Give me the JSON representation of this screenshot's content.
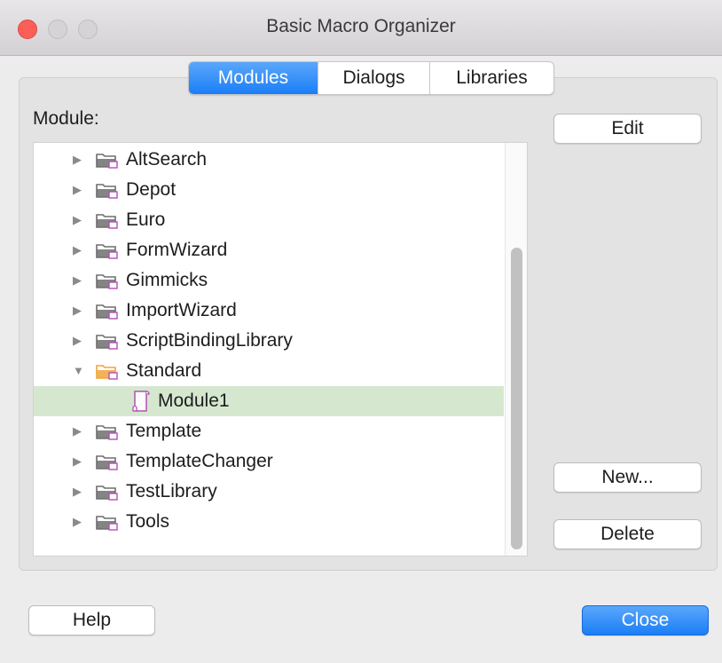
{
  "window": {
    "title": "Basic Macro Organizer"
  },
  "tabs": [
    {
      "label": "Modules",
      "active": true
    },
    {
      "label": "Dialogs",
      "active": false
    },
    {
      "label": "Libraries",
      "active": false
    }
  ],
  "module_label": "Module:",
  "tree": {
    "items": [
      {
        "label": "AltSearch",
        "expanded": false
      },
      {
        "label": "Depot",
        "expanded": false
      },
      {
        "label": "Euro",
        "expanded": false
      },
      {
        "label": "FormWizard",
        "expanded": false
      },
      {
        "label": "Gimmicks",
        "expanded": false
      },
      {
        "label": "ImportWizard",
        "expanded": false
      },
      {
        "label": "ScriptBindingLibrary",
        "expanded": false
      },
      {
        "label": "Standard",
        "expanded": true
      },
      {
        "label": "Module1",
        "child": true,
        "selected": true
      },
      {
        "label": "Template",
        "expanded": false
      },
      {
        "label": "TemplateChanger",
        "expanded": false
      },
      {
        "label": "TestLibrary",
        "expanded": false
      },
      {
        "label": "Tools",
        "expanded": false
      }
    ]
  },
  "buttons": {
    "edit": "Edit",
    "new": "New...",
    "delete": "Delete",
    "help": "Help",
    "close": "Close"
  },
  "colors": {
    "accent": "#1b7ef7",
    "selection": "#d5e8cf",
    "folder": "#6e6e6e",
    "folder_open": "#f2a33a",
    "badge": "#b44fb7"
  }
}
